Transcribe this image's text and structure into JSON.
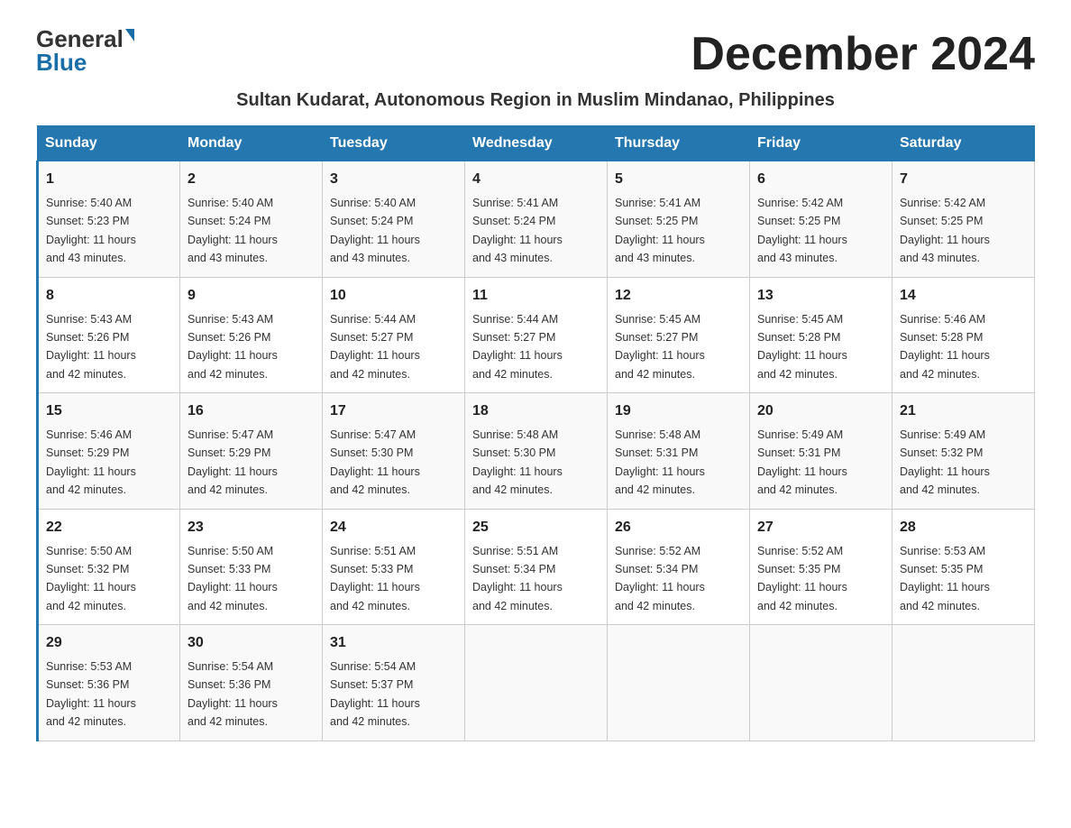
{
  "logo": {
    "general": "General",
    "blue": "Blue",
    "aria": "GeneralBlue logo"
  },
  "title": "December 2024",
  "subtitle": "Sultan Kudarat, Autonomous Region in Muslim Mindanao, Philippines",
  "days_of_week": [
    "Sunday",
    "Monday",
    "Tuesday",
    "Wednesday",
    "Thursday",
    "Friday",
    "Saturday"
  ],
  "weeks": [
    [
      {
        "day": "1",
        "sunrise": "5:40 AM",
        "sunset": "5:23 PM",
        "daylight": "11 hours and 43 minutes."
      },
      {
        "day": "2",
        "sunrise": "5:40 AM",
        "sunset": "5:24 PM",
        "daylight": "11 hours and 43 minutes."
      },
      {
        "day": "3",
        "sunrise": "5:40 AM",
        "sunset": "5:24 PM",
        "daylight": "11 hours and 43 minutes."
      },
      {
        "day": "4",
        "sunrise": "5:41 AM",
        "sunset": "5:24 PM",
        "daylight": "11 hours and 43 minutes."
      },
      {
        "day": "5",
        "sunrise": "5:41 AM",
        "sunset": "5:25 PM",
        "daylight": "11 hours and 43 minutes."
      },
      {
        "day": "6",
        "sunrise": "5:42 AM",
        "sunset": "5:25 PM",
        "daylight": "11 hours and 43 minutes."
      },
      {
        "day": "7",
        "sunrise": "5:42 AM",
        "sunset": "5:25 PM",
        "daylight": "11 hours and 43 minutes."
      }
    ],
    [
      {
        "day": "8",
        "sunrise": "5:43 AM",
        "sunset": "5:26 PM",
        "daylight": "11 hours and 42 minutes."
      },
      {
        "day": "9",
        "sunrise": "5:43 AM",
        "sunset": "5:26 PM",
        "daylight": "11 hours and 42 minutes."
      },
      {
        "day": "10",
        "sunrise": "5:44 AM",
        "sunset": "5:27 PM",
        "daylight": "11 hours and 42 minutes."
      },
      {
        "day": "11",
        "sunrise": "5:44 AM",
        "sunset": "5:27 PM",
        "daylight": "11 hours and 42 minutes."
      },
      {
        "day": "12",
        "sunrise": "5:45 AM",
        "sunset": "5:27 PM",
        "daylight": "11 hours and 42 minutes."
      },
      {
        "day": "13",
        "sunrise": "5:45 AM",
        "sunset": "5:28 PM",
        "daylight": "11 hours and 42 minutes."
      },
      {
        "day": "14",
        "sunrise": "5:46 AM",
        "sunset": "5:28 PM",
        "daylight": "11 hours and 42 minutes."
      }
    ],
    [
      {
        "day": "15",
        "sunrise": "5:46 AM",
        "sunset": "5:29 PM",
        "daylight": "11 hours and 42 minutes."
      },
      {
        "day": "16",
        "sunrise": "5:47 AM",
        "sunset": "5:29 PM",
        "daylight": "11 hours and 42 minutes."
      },
      {
        "day": "17",
        "sunrise": "5:47 AM",
        "sunset": "5:30 PM",
        "daylight": "11 hours and 42 minutes."
      },
      {
        "day": "18",
        "sunrise": "5:48 AM",
        "sunset": "5:30 PM",
        "daylight": "11 hours and 42 minutes."
      },
      {
        "day": "19",
        "sunrise": "5:48 AM",
        "sunset": "5:31 PM",
        "daylight": "11 hours and 42 minutes."
      },
      {
        "day": "20",
        "sunrise": "5:49 AM",
        "sunset": "5:31 PM",
        "daylight": "11 hours and 42 minutes."
      },
      {
        "day": "21",
        "sunrise": "5:49 AM",
        "sunset": "5:32 PM",
        "daylight": "11 hours and 42 minutes."
      }
    ],
    [
      {
        "day": "22",
        "sunrise": "5:50 AM",
        "sunset": "5:32 PM",
        "daylight": "11 hours and 42 minutes."
      },
      {
        "day": "23",
        "sunrise": "5:50 AM",
        "sunset": "5:33 PM",
        "daylight": "11 hours and 42 minutes."
      },
      {
        "day": "24",
        "sunrise": "5:51 AM",
        "sunset": "5:33 PM",
        "daylight": "11 hours and 42 minutes."
      },
      {
        "day": "25",
        "sunrise": "5:51 AM",
        "sunset": "5:34 PM",
        "daylight": "11 hours and 42 minutes."
      },
      {
        "day": "26",
        "sunrise": "5:52 AM",
        "sunset": "5:34 PM",
        "daylight": "11 hours and 42 minutes."
      },
      {
        "day": "27",
        "sunrise": "5:52 AM",
        "sunset": "5:35 PM",
        "daylight": "11 hours and 42 minutes."
      },
      {
        "day": "28",
        "sunrise": "5:53 AM",
        "sunset": "5:35 PM",
        "daylight": "11 hours and 42 minutes."
      }
    ],
    [
      {
        "day": "29",
        "sunrise": "5:53 AM",
        "sunset": "5:36 PM",
        "daylight": "11 hours and 42 minutes."
      },
      {
        "day": "30",
        "sunrise": "5:54 AM",
        "sunset": "5:36 PM",
        "daylight": "11 hours and 42 minutes."
      },
      {
        "day": "31",
        "sunrise": "5:54 AM",
        "sunset": "5:37 PM",
        "daylight": "11 hours and 42 minutes."
      },
      null,
      null,
      null,
      null
    ]
  ],
  "labels": {
    "sunrise": "Sunrise:",
    "sunset": "Sunset:",
    "daylight": "Daylight:"
  }
}
